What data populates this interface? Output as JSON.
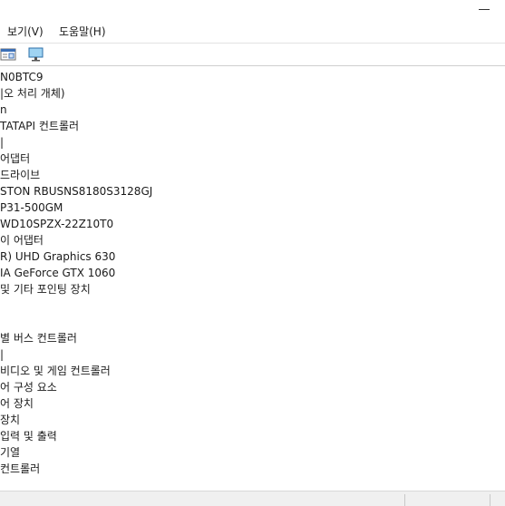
{
  "menu": {
    "view": "보기(V)",
    "help": "도움말(H)"
  },
  "toolbar": {
    "icons": [
      "properties-pane-icon",
      "monitor-icon"
    ]
  },
  "tree": {
    "rows": [
      "N0BTC9",
      "|오 처리 개체)",
      "n",
      "TATAPI 컨트롤러",
      "|",
      "어댑터",
      "드라이브",
      "STON RBUSNS8180S3128GJ",
      "P31-500GM",
      "WD10SPZX-22Z10T0",
      "이 어댑터",
      "R) UHD Graphics 630",
      "IA GeForce GTX 1060",
      "및 기타 포인팅 장치",
      "",
      "",
      "별 버스 컨트롤러",
      "|",
      "비디오 및 게임 컨트롤러",
      "어 구성 요소",
      "어 장치",
      "장치",
      "입력 및 출력",
      "기열",
      "컨트롤러"
    ]
  }
}
